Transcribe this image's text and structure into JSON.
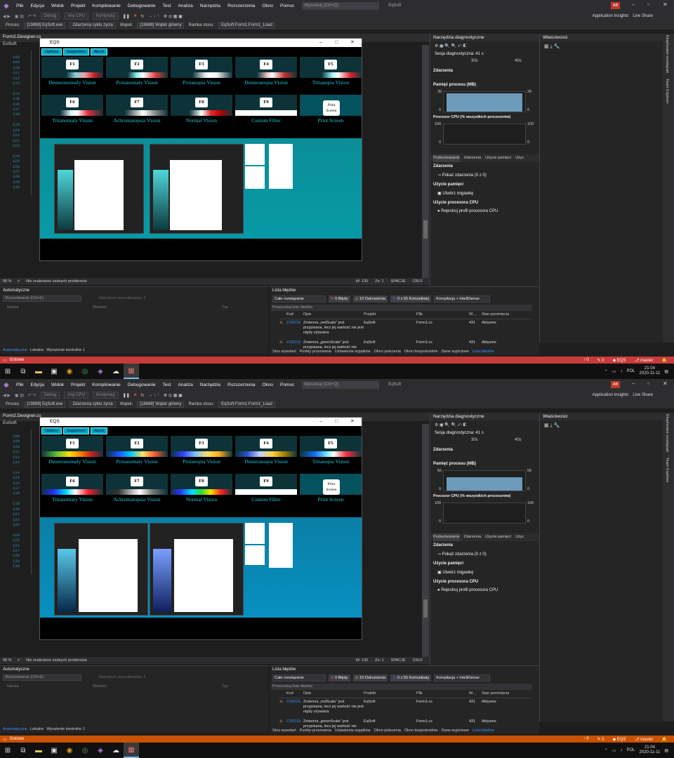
{
  "screens": {
    "top": {
      "menubar": {
        "items": [
          "Plik",
          "Edycja",
          "Widok",
          "Projekt",
          "Kompilowanie",
          "Debugowanie",
          "Test",
          "Analiza",
          "Narzędzia",
          "Rozszerzenia",
          "Okno",
          "Pomoc"
        ],
        "search_placeholder": "Wyszukaj (Ctrl+Q)",
        "project_name": "EqSoft",
        "avatar": "AB"
      },
      "toolbar": {
        "config": "Debug",
        "platform": "Any CPU",
        "continue": "Kontynuuj",
        "app_insights": "Application Insights",
        "live_share": "Live Share"
      },
      "toolbar2": {
        "process_label": "Proces:",
        "process_value": "[19888] EqSoft.exe",
        "lifecycle": "Zdarzenia cyklu życia",
        "thread_label": "Wątek:",
        "thread_value": "[18688] Wątek główny",
        "frame_label": "Ramka stosu:",
        "frame_value": "EqSoft.Form1.Form1_Load"
      },
      "editor": {
        "tab": "Form2.Designer.cs",
        "breadcrumb": "EqSoft",
        "line_numbers": [
          "108",
          "109",
          "110",
          "111",
          "112",
          "113",
          "",
          "114",
          "115",
          "116",
          "117",
          "118",
          "",
          "119",
          "120",
          "121",
          "122",
          "123",
          "",
          "124",
          "125",
          "126",
          "127",
          "128",
          "129",
          "130"
        ]
      },
      "eqs": {
        "title": "EQS",
        "menu": [
          "Options",
          "Supporters",
          "About"
        ],
        "filters": [
          {
            "key": "F1",
            "label": "Deuteranomaly Vision"
          },
          {
            "key": "F2",
            "label": "Protanomaly Vision"
          },
          {
            "key": "F3",
            "label": "Protanopia Vision"
          },
          {
            "key": "F4",
            "label": "Deuteranopia Vision"
          },
          {
            "key": "F5",
            "label": "Tritanopia Vision"
          },
          {
            "key": "F6",
            "label": "Tritanomaly Vision"
          },
          {
            "key": "F7",
            "label": "Achromatopsia Vision"
          },
          {
            "key": "F8",
            "label": "Normal Vision"
          },
          {
            "key": "F9",
            "label": "Custom Filter"
          },
          {
            "key": "Print Screen",
            "label": "Print Screen"
          }
        ]
      },
      "status": {
        "zoom": "98 %",
        "no_issues": "Nie znaleziono żadnych problemów",
        "pos_w": "W: 130",
        "pos_zn": "Zn: 1",
        "spacje": "SPACJE",
        "crlf": "CRLF"
      },
      "diagnostics": {
        "title": "Narzędzia diagnostyczne",
        "session": "Sesja diagnostyczna: 41 s",
        "t30": "30s",
        "t40": "40s",
        "events": "Zdarzenia",
        "memory": "Pamięć procesu (MB)",
        "mem_max": "39",
        "mem_min": "0",
        "cpu": "Procesor CPU (% wszystkich procesorów)",
        "cpu_max": "100",
        "cpu_min": "0",
        "tabs": [
          "Podsumowanie",
          "Zdarzenia",
          "Użycie pamięci",
          "Użyc"
        ],
        "sec_events": "Zdarzenia",
        "show_events": "Pokaż zdarzenia (0 z 0)",
        "sec_memory": "Użycie pamięci",
        "snapshot": "Utwórz migawkę",
        "sec_cpu": "Użycie procesora CPU",
        "cpu_profile": "Rejestruj profil procesora CPU"
      },
      "props": {
        "title": "Właściwości"
      },
      "sidetabs": [
        "Eksplorator rozwiązań",
        "Team Explorer"
      ],
      "autos": {
        "title": "Automatyczne",
        "search": "Wyszukiwanie (Ctrl+E)",
        "depth_label": "Głębokość wyszukiwania:",
        "depth_value": "3",
        "col_name": "Nazwa",
        "col_value": "Wartość",
        "col_type": "Typ",
        "tabs": [
          "Automatyczne",
          "Lokalne",
          "Wyrażenie kontrolne 1"
        ]
      },
      "errors": {
        "title": "Lista błędów",
        "scope": "Całe rozwiązanie",
        "err_count": "0 Błędy",
        "warn_count": "19 Ostrzeżenia",
        "msg_count": "0 z 55 Komunikaty",
        "build": "Kompilacja + IntelliSense",
        "search": "Przeszukaj listę błędów",
        "headers": [
          "Kod",
          "Opis",
          "Projekt",
          "Plik",
          "W...",
          "Stan pominięcia"
        ],
        "rows": [
          {
            "code": "CS0219",
            "desc": "Zmienna „redScale” jest przypisana, lecz jej wartość nie jest nigdy używana",
            "project": "EqSoft",
            "file": "Form1.cs",
            "line": "431",
            "state": "Aktywne"
          },
          {
            "code": "CS0219",
            "desc": "Zmienna „greenScale” jest przypisana, lecz jej wartość nie",
            "project": "EqSoft",
            "file": "Form1.cs",
            "line": "431",
            "state": "Aktywne"
          }
        ],
        "tabs": [
          "Stos wywołań",
          "Punkty przerwania",
          "Ustawienia wyjątków",
          "Okno polecenia",
          "Okno bezpośrednie",
          "Dane wyjściowe",
          "Lista błędów"
        ]
      },
      "vs_status": {
        "ready": "Gotowe",
        "up": "0",
        "pencil": "0",
        "repo": "EQS",
        "branch": "master"
      },
      "taskbar": {
        "lang": "POL",
        "time": "21:04",
        "date": "2020-11-11"
      }
    },
    "bottom": {
      "menubar": {
        "items": [
          "Plik",
          "Edycja",
          "Widok",
          "Projekt",
          "Kompilowanie",
          "Debugowanie",
          "Test",
          "Analiza",
          "Narzędzia",
          "Rozszerzenia",
          "Okno",
          "Pomoc"
        ],
        "search_placeholder": "Wyszukaj (Ctrl+Q)",
        "project_name": "EqSoft",
        "avatar": "AB"
      },
      "toolbar": {
        "config": "Debug",
        "platform": "Any CPU",
        "continue": "Kontynuuj",
        "app_insights": "Application Insights",
        "live_share": "Live Share"
      },
      "toolbar2": {
        "process_label": "Proces:",
        "process_value": "[19888] EqSoft.exe",
        "lifecycle": "Zdarzenia cyklu życia",
        "thread_label": "Wątek:",
        "thread_value": "[18688] Wątek główny",
        "frame_label": "Ramka stosu:",
        "frame_value": "EqSoft.Form1.Form1_Load"
      },
      "editor": {
        "tab": "Form2.Designer.cs",
        "breadcrumb": "EqSoft",
        "line_numbers": [
          "108",
          "109",
          "110",
          "111",
          "112",
          "113",
          "",
          "114",
          "115",
          "116",
          "117",
          "118",
          "",
          "119",
          "120",
          "121",
          "122",
          "123",
          "",
          "124",
          "125",
          "126",
          "127",
          "128",
          "129",
          "130"
        ]
      },
      "eqs": {
        "title": "EQS",
        "menu": [
          "Options",
          "Supporters",
          "About"
        ],
        "filters": [
          {
            "key": "F1",
            "label": "Deuteranomaly Vision"
          },
          {
            "key": "F2",
            "label": "Protanomaly Vision"
          },
          {
            "key": "F3",
            "label": "Protanopia Vision"
          },
          {
            "key": "F4",
            "label": "Deuteranopia Vision"
          },
          {
            "key": "F5",
            "label": "Tritanopia Vision"
          },
          {
            "key": "F6",
            "label": "Tritanomaly Vision"
          },
          {
            "key": "F7",
            "label": "Achromatopsia Vision"
          },
          {
            "key": "F8",
            "label": "Normal Vision"
          },
          {
            "key": "F9",
            "label": "Custom Filter"
          },
          {
            "key": "Print Screen",
            "label": "Print Screen"
          }
        ]
      },
      "status": {
        "zoom": "98 %",
        "no_issues": "Nie znaleziono żadnych problemów",
        "pos_w": "W: 130",
        "pos_zn": "Zn: 1",
        "spacje": "SPACJE",
        "crlf": "CRLF"
      },
      "diagnostics": {
        "title": "Narzędzia diagnostyczne",
        "session": "Sesja diagnostyczna: 41 s",
        "t30": "30s",
        "t40": "40s",
        "events": "Zdarzenia",
        "memory": "Pamięć procesu (MB)",
        "mem_max": "56",
        "mem_min": "0",
        "cpu": "Procesor CPU (% wszystkich procesorów)",
        "cpu_max": "100",
        "cpu_min": "0",
        "tabs": [
          "Podsumowanie",
          "Zdarzenia",
          "Użycie pamięci",
          "Użyc"
        ],
        "sec_events": "Zdarzenia",
        "show_events": "Pokaż zdarzenia (0 z 0)",
        "sec_memory": "Użycie pamięci",
        "snapshot": "Utwórz migawkę",
        "sec_cpu": "Użycie procesora CPU",
        "cpu_profile": "Rejestruj profil procesora CPU"
      },
      "props": {
        "title": "Właściwości"
      },
      "sidetabs": [
        "Eksplorator rozwiązań",
        "Team Explorer"
      ],
      "autos": {
        "title": "Automatyczne",
        "search": "Wyszukiwanie (Ctrl+E)",
        "depth_label": "Głębokość wyszukiwania:",
        "depth_value": "3",
        "col_name": "Nazwa",
        "col_value": "Wartość",
        "col_type": "Typ",
        "tabs": [
          "Automatyczne",
          "Lokalne",
          "Wyrażenie kontrolne 1"
        ]
      },
      "errors": {
        "title": "Lista błędów",
        "scope": "Całe rozwiązanie",
        "err_count": "0 Błędy",
        "warn_count": "19 Ostrzeżenia",
        "msg_count": "0 z 55 Komunikaty",
        "build": "Kompilacja + IntelliSense",
        "search": "Przeszukaj listę błędów",
        "headers": [
          "Kod",
          "Opis",
          "Projekt",
          "Plik",
          "W...",
          "Stan pominięcia"
        ],
        "rows": [
          {
            "code": "CS0219",
            "desc": "Zmienna „redScale” jest przypisana, lecz jej wartość nie jest nigdy używana",
            "project": "EqSoft",
            "file": "Form1.cs",
            "line": "431",
            "state": "Aktywne"
          },
          {
            "code": "CS0219",
            "desc": "Zmienna „greenScale” jest przypisana, lecz jej wartość nie",
            "project": "EqSoft",
            "file": "Form1.cs",
            "line": "431",
            "state": "Aktywne"
          }
        ],
        "tabs": [
          "Stos wywołań",
          "Punkty przerwania",
          "Ustawienia wyjątków",
          "Okno polecenia",
          "Okno bezpośrednie",
          "Dane wyjściowe",
          "Lista błędów"
        ]
      },
      "vs_status": {
        "ready": "Gotowe",
        "up": "0",
        "pencil": "0",
        "repo": "EQS",
        "branch": "master"
      },
      "taskbar": {
        "lang": "POL",
        "time": "21:04",
        "date": "2020-11-11"
      }
    }
  },
  "colors": {
    "status_top": "#c93a3a",
    "status_bottom": "#ca5100",
    "accent": "#1fc9d8"
  },
  "gradients": {
    "top": [
      "linear-gradient(90deg,#0d3338 0%,#0d3338 40%,#7fd3d8 55%,#f0a0a0 70%,#c8202a 85%,#0d3338 100%)",
      "linear-gradient(90deg,#0d3338 0%,#0d3338 35%,#8ff0f5 50%,#fff 60%,#e04040 80%,#0d3338 100%)",
      "linear-gradient(90deg,#0d3338 0%,#0d3338 35%,#e0e0e0 55%,#fff 62%,#f0f0f0 75%,#0d3338 100%)",
      "linear-gradient(90deg,#0d3338 0%,#0d3338 35%,#f5c0c8 52%,#fff 60%,#c03030 80%,#0d3338 100%)",
      "linear-gradient(90deg,#0d3338 0%,#0d3338 35%,#a0f0f5 52%,#fff 62%,#e02030 82%,#0d3338 100%)",
      "linear-gradient(90deg,#0d3338 0%,#0d3338 30%,#e0f8fa 48%,#fff 58%,#e83040 75%,#0d3338 100%)",
      "linear-gradient(90deg,#0d3338 0%,#0d3338 30%,#bbb 50%,#fff 60%,#888 80%,#0d3338 100%)",
      "linear-gradient(90deg,#0d3338 0%,#0d3338 30%,#fff 50%,#e03030 65%,#c00000 80%,#0d3338 100%)",
      "linear-gradient(90deg,#fff 0%,#fff 100%)",
      "linear-gradient(90deg,#04525e,#04525e)"
    ],
    "bottom": [
      "linear-gradient(90deg,#0d3338 0%,#5fbf3a 25%,#ffe000 45%,#ff8800 62%,#d02020 80%,#0d3338 100%)",
      "linear-gradient(90deg,#0d3338 0%,#2050ff 20%,#00c8ff 40%,#ffe060 60%,#ff6030 78%,#0d3338 100%)",
      "linear-gradient(90deg,#0d3338 0%,#3040ff 20%,#80c0ff 40%,#ffe060 60%,#ffb020 78%,#0d3338 100%)",
      "linear-gradient(90deg,#0d3338 0%,#3050d0 20%,#c0d0ff 40%,#ffd040 60%,#a08000 80%,#0d3338 100%)",
      "linear-gradient(90deg,#0d3338 0%,#1070ff 25%,#80f0ff 45%,#fff 55%,#ff3040 75%,#0d3338 100%)",
      "linear-gradient(90deg,#0d3338 0%,#2030ff 20%,#00d8ff 40%,#fff 55%,#ff2030 75%,#0d3338 100%)",
      "linear-gradient(90deg,#0d3338 0%,#333 20%,#ccc 45%,#fff 55%,#777 75%,#0d3338 100%)",
      "linear-gradient(90deg,#0d3338 0%,#3030ff 15%,#00e0ff 35%,#30e030 50%,#ffe000 65%,#ff2020 82%,#0d3338 100%)",
      "linear-gradient(90deg,#fff 0%,#fff 100%)",
      "linear-gradient(90deg,#04525e,#04525e)"
    ]
  }
}
